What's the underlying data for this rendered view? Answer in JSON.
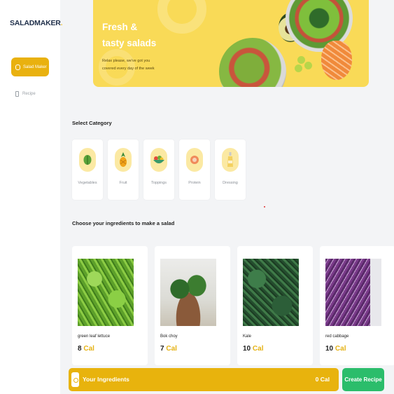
{
  "brand": {
    "name": "SALADMAKER",
    "dot": "."
  },
  "sidebar": {
    "items": [
      {
        "label": "Salad Maker",
        "active": true,
        "icon": "salad-icon"
      },
      {
        "label": "Recipe",
        "active": false,
        "icon": "document-icon"
      }
    ]
  },
  "banner": {
    "title_line1": "Fresh &",
    "title_line2": "tasty salads",
    "subtitle_line1": "Relax please, we've got you",
    "subtitle_line2": "covered every day of the week"
  },
  "categories": {
    "title": "Select Category",
    "items": [
      {
        "label": "Vegetables",
        "icon": "vegetables-icon"
      },
      {
        "label": "Fruit",
        "icon": "pineapple-icon"
      },
      {
        "label": "Toppings",
        "icon": "toppings-bowl-icon"
      },
      {
        "label": "Protein",
        "icon": "protein-icon"
      },
      {
        "label": "Dressing",
        "icon": "dressing-bottle-icon"
      }
    ]
  },
  "ingredients": {
    "title": "Choose your ingredients to make a salad",
    "items": [
      {
        "name": "green leaf lettuce",
        "cal_value": "8",
        "cal_unit": "Cal"
      },
      {
        "name": "Bok choy",
        "cal_value": "7",
        "cal_unit": "Cal"
      },
      {
        "name": "Kale",
        "cal_value": "10",
        "cal_unit": "Cal"
      },
      {
        "name": "red cabbage",
        "cal_value": "10",
        "cal_unit": "Cal"
      }
    ]
  },
  "bottom_bar": {
    "label": "Your Ingredients",
    "total": "0 Cal",
    "create_button": "Create Recipe"
  },
  "colors": {
    "accent": "#e8b30d",
    "banner": "#f9da57",
    "create": "#2bbd6b"
  }
}
